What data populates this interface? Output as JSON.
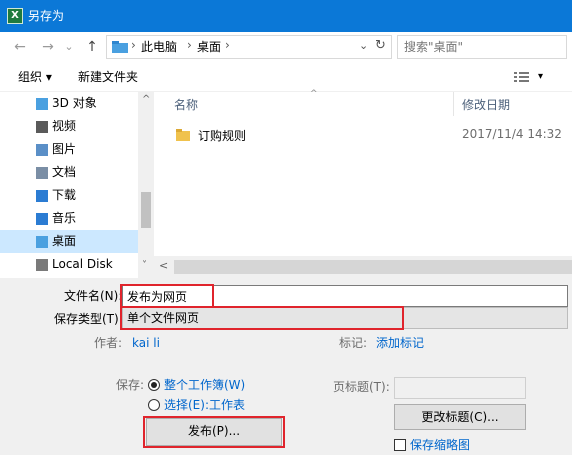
{
  "titlebar": {
    "app_icon": "excel-icon",
    "app_icon_glyph": "X",
    "title": "另存为"
  },
  "nav": {
    "back": "←",
    "forward": "→",
    "recent": "⌄",
    "up": "↑",
    "breadcrumb": [
      "此电脑",
      "桌面"
    ],
    "crumb_sep": "›",
    "dropdown": "⌄",
    "refresh": "↻",
    "search_placeholder": "搜索\"桌面\""
  },
  "toolbar": {
    "organize": "组织 ▾",
    "new_folder": "新建文件夹",
    "view_icon": "view-list-icon",
    "view_dropdown": "▾"
  },
  "tree": {
    "items": [
      {
        "label": "3D 对象",
        "icon": "3d-objects-icon",
        "color": "#4aa0e0",
        "selected": false
      },
      {
        "label": "视频",
        "icon": "video-icon",
        "color": "#5a5a5a",
        "selected": false
      },
      {
        "label": "图片",
        "icon": "pictures-icon",
        "color": "#5a8fc7",
        "selected": false
      },
      {
        "label": "文档",
        "icon": "documents-icon",
        "color": "#7a8ea5",
        "selected": false
      },
      {
        "label": "下载",
        "icon": "downloads-icon",
        "color": "#2b7cd3",
        "selected": false
      },
      {
        "label": "音乐",
        "icon": "music-icon",
        "color": "#2b7cd3",
        "selected": false
      },
      {
        "label": "桌面",
        "icon": "desktop-icon",
        "color": "#4aa0e0",
        "selected": true
      },
      {
        "label": "Local Disk (C:)",
        "icon": "drive-icon",
        "color": "#7a7a7a",
        "selected": false
      }
    ],
    "scroll_up": "^",
    "scroll_down": "˅"
  },
  "filelist": {
    "columns": [
      "名称",
      "修改日期"
    ],
    "sort_caret": "^",
    "rows": [
      {
        "name": "订购规则",
        "date": "2017/11/4 14:32",
        "icon": "folder-icon"
      }
    ],
    "hscroll_left": "<"
  },
  "form": {
    "filename_label": "文件名(N):",
    "filename_value": "发布为网页",
    "type_label": "保存类型(T):",
    "type_value": "单个文件网页",
    "author_label": "作者:",
    "author_value": "kai li",
    "tags_label": "标记:",
    "tags_value": "添加标记",
    "save_label": "保存:",
    "save_option_workbook": "整个工作簿(W)",
    "save_option_sheet": "选择(E):工作表",
    "page_title_label": "页标题(T):",
    "change_title_button": "更改标题(C)...",
    "publish_button": "发布(P)...",
    "save_thumbnail": "保存缩略图"
  },
  "colors": {
    "accent": "#0b78d7",
    "highlight": "#e0242c",
    "link": "#0066cc",
    "selection": "#cce8ff"
  }
}
